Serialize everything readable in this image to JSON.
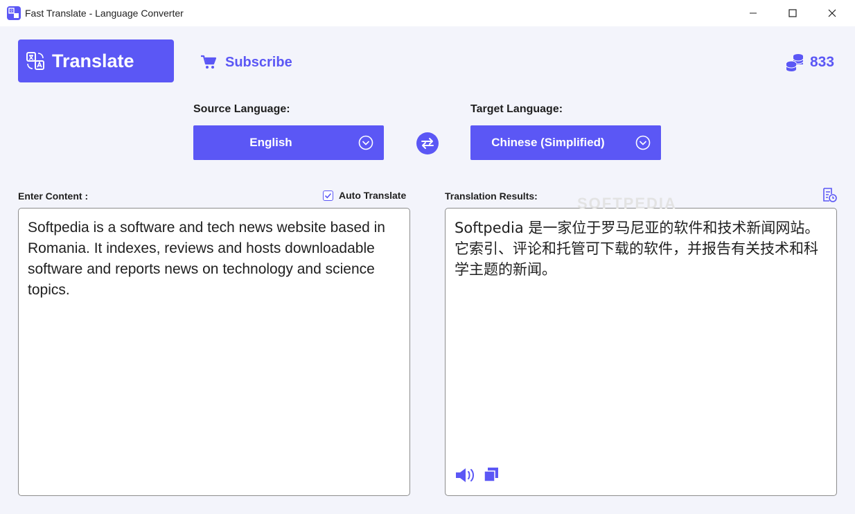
{
  "window": {
    "title": "Fast Translate - Language Converter",
    "app_icon": "translate-app-icon",
    "controls": [
      "minimize-icon",
      "maximize-icon",
      "close-icon"
    ]
  },
  "toolbar": {
    "translate_label": "Translate",
    "subscribe_label": "Subscribe",
    "credits": "833"
  },
  "languages": {
    "source_label": "Source Language:",
    "source_value": "English",
    "target_label": "Target Language:",
    "target_value": "Chinese (Simplified)"
  },
  "input": {
    "label": "Enter Content :",
    "auto_translate_label": "Auto Translate",
    "auto_translate_checked": true,
    "text": "Softpedia is a software and tech news website based in Romania. It indexes, reviews and hosts downloadable software and reports news on technology and science topics."
  },
  "output": {
    "label": "Translation Results:",
    "text": "Softpedia 是一家位于罗马尼亚的软件和技术新闻网站。它索引、评论和托管可下载的软件，并报告有关技术和科学主题的新闻。",
    "watermark": "SOFTPEDIA"
  },
  "colors": {
    "accent": "#5b57f5",
    "background": "#f3f4fb",
    "panel": "#ffffff"
  }
}
